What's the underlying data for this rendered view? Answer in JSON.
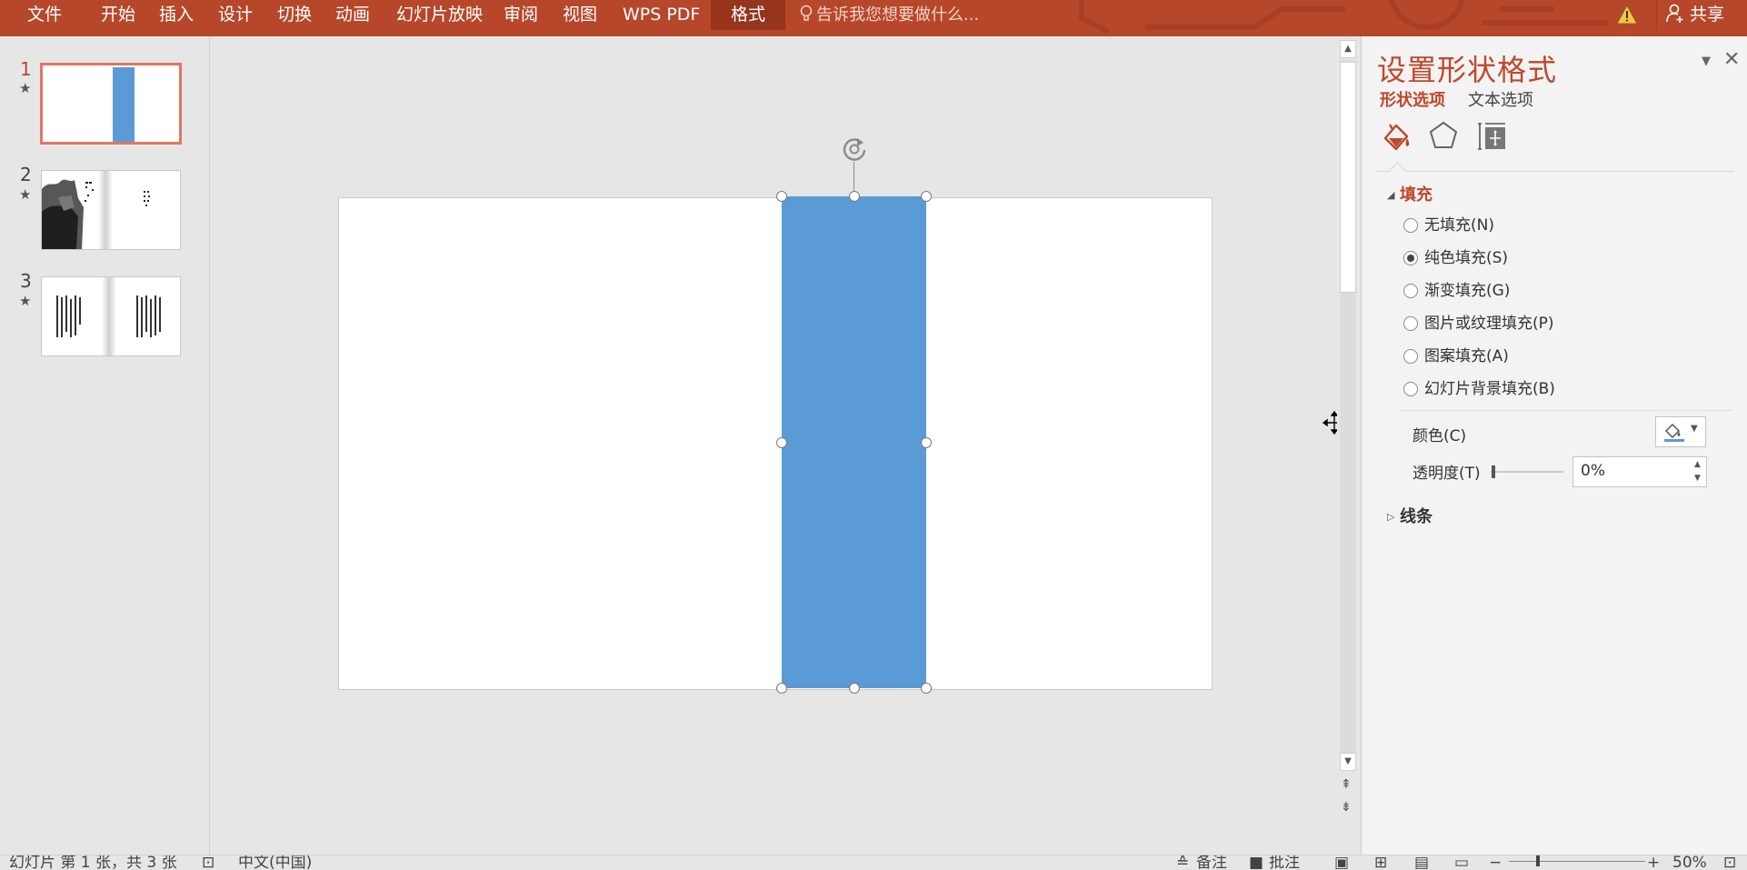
{
  "ribbon": {
    "tabs": [
      "文件",
      "开始",
      "插入",
      "设计",
      "切换",
      "动画",
      "幻灯片放映",
      "审阅",
      "视图",
      "WPS PDF"
    ],
    "active_tab": "格式",
    "tell_me_placeholder": "告诉我您想要做什么...",
    "share_label": "共享",
    "warning_icon": "warning-icon"
  },
  "thumbnails": [
    {
      "number": "1",
      "selected": true
    },
    {
      "number": "2",
      "selected": false
    },
    {
      "number": "3",
      "selected": false
    }
  ],
  "slide": {
    "shape_color": "#5b9bd5"
  },
  "format_pane": {
    "title": "设置形状格式",
    "tabs": {
      "shape": "形状选项",
      "text": "文本选项"
    },
    "fill_section": {
      "title": "填充",
      "options": [
        {
          "label": "无填充(N)",
          "selected": false
        },
        {
          "label": "纯色填充(S)",
          "selected": true
        },
        {
          "label": "渐变填充(G)",
          "selected": false
        },
        {
          "label": "图片或纹理填充(P)",
          "selected": false
        },
        {
          "label": "图案填充(A)",
          "selected": false
        },
        {
          "label": "幻灯片背景填充(B)",
          "selected": false
        }
      ],
      "color_label": "颜色(C)",
      "transparency_label": "透明度(T)",
      "transparency_value": "0%",
      "transparency": 0
    },
    "line_section": {
      "title": "线条"
    }
  },
  "status_bar": {
    "slide_info": "幻灯片 第 1 张，共 3 张",
    "language": "中文(中国)",
    "notes": "备注",
    "comments": "批注",
    "zoom": "50%"
  },
  "colors": {
    "accent": "#b7472a",
    "pane_accent": "#c0472b",
    "shape_fill": "#5b9bd5"
  }
}
